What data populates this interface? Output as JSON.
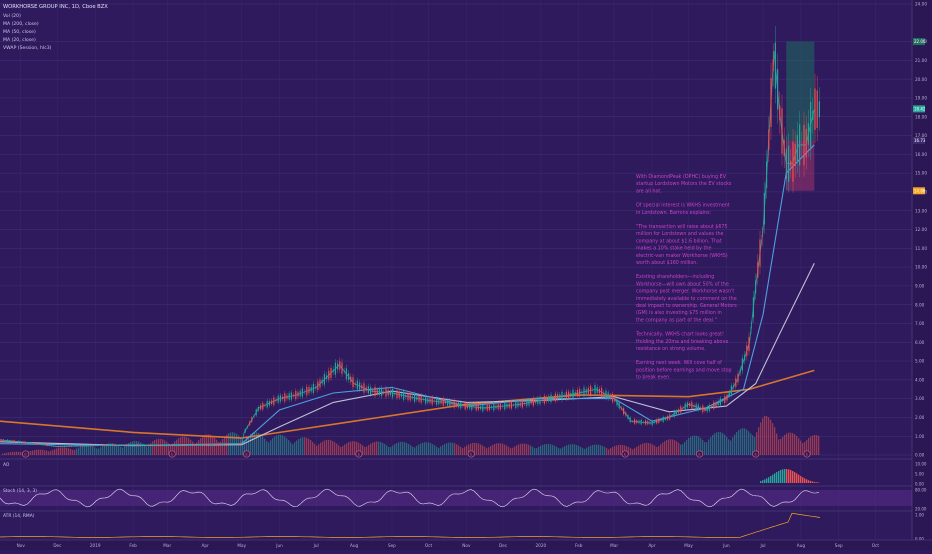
{
  "chart_data": {
    "type": "line",
    "title": "WORKHORSE GROUP INC, 1D, Cboe BZX",
    "indicators": [
      "Vol (20)",
      "MA (200, close)",
      "MA (50, close)",
      "MA (20, close)",
      "VWAP (Session, hlc3)"
    ],
    "x_labels": [
      "Nov",
      "Dec",
      "2019",
      "Feb",
      "Mar",
      "Apr",
      "May",
      "Jun",
      "Jul",
      "Aug",
      "Sep",
      "Oct",
      "Nov",
      "Dec",
      "2020",
      "Feb",
      "Mar",
      "Apr",
      "May",
      "Jun",
      "Jul",
      "Aug",
      "Sep",
      "Oct"
    ],
    "y_ticks": [
      "24.00",
      "22.00",
      "21.00",
      "20.00",
      "19.00",
      "18.00",
      "17.00",
      "16.00",
      "15.00",
      "14.00",
      "13.00",
      "12.00",
      "11.00",
      "10.00",
      "9.00",
      "8.00",
      "7.00",
      "6.00",
      "5.00",
      "4.00",
      "3.00",
      "2.00",
      "1.00",
      "0.00"
    ],
    "price_badges": [
      {
        "text": "22.00",
        "value": 22.0,
        "color": "#1f6e5e"
      },
      {
        "text": "18.42",
        "value": 18.42,
        "color": "#26a69a"
      },
      {
        "text": "16.73",
        "value": 16.73,
        "color": "#3d2a6e"
      },
      {
        "text": "14.06",
        "value": 14.06,
        "color": "#f5a623"
      }
    ],
    "price_series": {
      "name": "close",
      "x": [
        "2018-10-15",
        "2018-11-01",
        "2018-12-01",
        "2019-01-01",
        "2019-02-01",
        "2019-03-01",
        "2019-04-01",
        "2019-05-01",
        "2019-05-03",
        "2019-05-15",
        "2019-06-01",
        "2019-06-15",
        "2019-07-01",
        "2019-07-20",
        "2019-08-01",
        "2019-08-15",
        "2019-09-01",
        "2019-09-15",
        "2019-10-01",
        "2019-10-15",
        "2019-11-01",
        "2019-11-15",
        "2019-12-01",
        "2019-12-15",
        "2020-01-01",
        "2020-01-15",
        "2020-02-01",
        "2020-02-15",
        "2020-03-01",
        "2020-03-15",
        "2020-04-01",
        "2020-04-15",
        "2020-05-01",
        "2020-05-15",
        "2020-06-01",
        "2020-06-10",
        "2020-06-20",
        "2020-06-25",
        "2020-07-01",
        "2020-07-05",
        "2020-07-10",
        "2020-07-15",
        "2020-07-20",
        "2020-07-25",
        "2020-07-30",
        "2020-08-05",
        "2020-08-12"
      ],
      "y": [
        0.8,
        0.7,
        0.45,
        0.5,
        0.55,
        0.5,
        0.55,
        0.6,
        1.2,
        2.5,
        3.0,
        3.2,
        3.6,
        4.8,
        3.8,
        3.4,
        3.3,
        3.1,
        2.9,
        2.8,
        2.6,
        2.5,
        2.6,
        2.7,
        2.9,
        3.1,
        3.3,
        3.5,
        3.0,
        1.8,
        1.7,
        2.0,
        2.7,
        2.4,
        3.0,
        4.0,
        6.0,
        9.0,
        12.0,
        16.0,
        21.5,
        18.0,
        15.5,
        15.5,
        16.5,
        16.5,
        18.4
      ]
    },
    "ma_series": [
      {
        "name": "MA (200, close)",
        "color": "#e07a2a",
        "x": [
          "2018-10-15",
          "2019-02-01",
          "2019-05-01",
          "2019-08-01",
          "2019-11-01",
          "2020-02-01",
          "2020-05-01",
          "2020-06-20",
          "2020-08-12"
        ],
        "y": [
          1.8,
          1.2,
          0.9,
          1.8,
          2.7,
          3.2,
          3.1,
          3.5,
          4.5
        ]
      },
      {
        "name": "MA (50, close)",
        "color": "#c8c8dc",
        "x": [
          "2018-10-15",
          "2019-02-01",
          "2019-05-01",
          "2019-06-01",
          "2019-07-15",
          "2019-09-01",
          "2019-11-01",
          "2020-01-01",
          "2020-03-01",
          "2020-04-15",
          "2020-06-01",
          "2020-06-25",
          "2020-07-15",
          "2020-08-12"
        ],
        "y": [
          0.7,
          0.5,
          0.55,
          1.5,
          2.8,
          3.4,
          2.8,
          2.9,
          3.1,
          2.3,
          2.6,
          3.8,
          6.5,
          10.2
        ]
      },
      {
        "name": "MA (20, close)",
        "color": "#4fa8e8",
        "x": [
          "2018-10-15",
          "2019-02-01",
          "2019-05-01",
          "2019-06-01",
          "2019-07-15",
          "2019-09-01",
          "2019-11-01",
          "2020-01-01",
          "2020-03-01",
          "2020-04-01",
          "2020-05-15",
          "2020-06-15",
          "2020-07-01",
          "2020-07-20",
          "2020-08-12"
        ],
        "y": [
          0.6,
          0.5,
          0.6,
          2.4,
          3.3,
          3.6,
          2.6,
          3.0,
          3.0,
          1.8,
          2.5,
          3.5,
          7.5,
          15.0,
          16.5
        ]
      }
    ],
    "volume_series": {
      "name": "Vol (20)",
      "x": [
        "2018-10-15",
        "2019-05-03",
        "2019-07-20",
        "2020-03-15",
        "2020-06-20",
        "2020-07-01",
        "2020-07-10",
        "2020-07-15",
        "2020-08-05"
      ],
      "y": [
        0.05,
        0.6,
        0.35,
        0.25,
        0.7,
        1.0,
        0.9,
        0.6,
        0.5
      ]
    },
    "position": {
      "entry": 16.73,
      "target": 22.0,
      "stop": 14.06,
      "start": "2020-07-20",
      "end": "2020-08-12"
    },
    "event_markers": [
      "E",
      "E",
      "E",
      "E",
      "E",
      "E",
      "E",
      "E",
      "E"
    ],
    "annotation": [
      "With DiamondPeak (DPHC) buying EV startup Lordstown Motors the EV stocks are all hot.",
      "Of special interest is WKHS investment in Lordstown. Barrons explains:",
      "\"The transaction will raise about $675 million for Lordstown and values the company at about $1.6 billion. That makes a 10% stake held by the electric-van maker Workhorse (WKHS) worth about $160 million.",
      "Existing shareholders—including Workhorse—will own about 50% of the company post merger. Workhorse wasn't immediately available to comment on the deal impact to ownership. General Motors (GM) is also investing $75 million in the company as part of the deal.\"",
      "Technically, WKHS chart looks great! Holding the 20ma and breaking above resistance on strong volume.",
      "Earning next week. Will cove half of position before earnings and move stop to break even."
    ],
    "panels": [
      {
        "title": "AO",
        "ticks": [
          "10.00",
          "5.00",
          "0.00"
        ]
      },
      {
        "title": "Stoch (14, 3, 3)",
        "ticks": [
          "80.00",
          "20.00"
        ]
      },
      {
        "title": "ATR (14, RMA)",
        "ticks": [
          "1.00",
          "0.00"
        ]
      }
    ]
  }
}
